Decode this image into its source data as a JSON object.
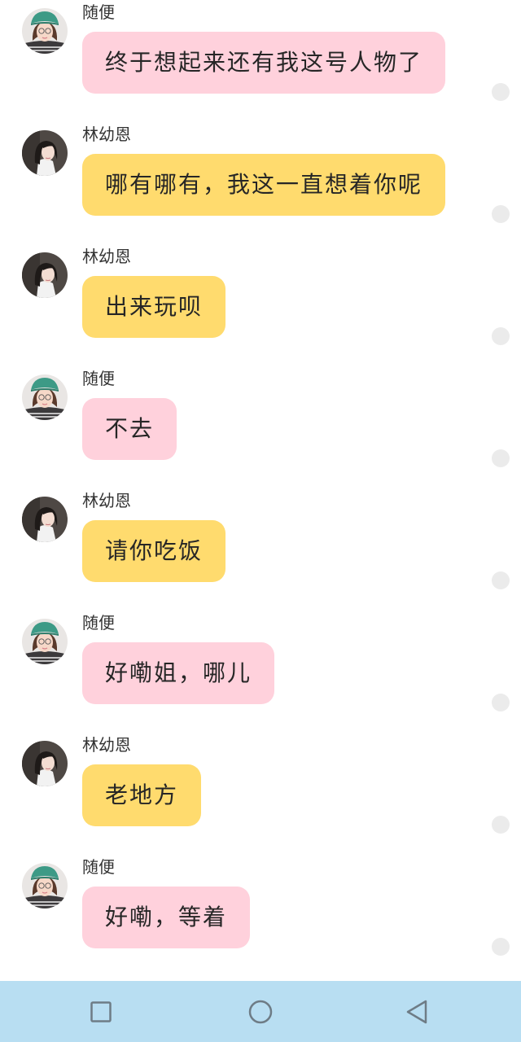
{
  "colors": {
    "pink_bubble": "#ffd1dc",
    "yellow_bubble": "#ffdb6e",
    "nav_bar": "#b8def2",
    "read_dot": "#ebebeb"
  },
  "messages": [
    {
      "sender": "随便",
      "text": "终于想起来还有我这号人物了",
      "bubble": "pink",
      "avatar": "green-cap-girl-avatar"
    },
    {
      "sender": "林幼恩",
      "text": "哪有哪有，我这一直想着你呢",
      "bubble": "yellow",
      "avatar": "dark-hair-girl-avatar"
    },
    {
      "sender": "林幼恩",
      "text": "出来玩呗",
      "bubble": "yellow",
      "avatar": "dark-hair-girl-avatar"
    },
    {
      "sender": "随便",
      "text": "不去",
      "bubble": "pink",
      "avatar": "green-cap-girl-avatar"
    },
    {
      "sender": "林幼恩",
      "text": "请你吃饭",
      "bubble": "yellow",
      "avatar": "dark-hair-girl-avatar"
    },
    {
      "sender": "随便",
      "text": "好嘞姐，哪儿",
      "bubble": "pink",
      "avatar": "green-cap-girl-avatar"
    },
    {
      "sender": "林幼恩",
      "text": "老地方",
      "bubble": "yellow",
      "avatar": "dark-hair-girl-avatar"
    },
    {
      "sender": "随便",
      "text": "好嘞，等着",
      "bubble": "pink",
      "avatar": "green-cap-girl-avatar"
    }
  ],
  "nav_bar": {
    "buttons": [
      "recent-apps-icon",
      "home-icon",
      "back-icon"
    ]
  }
}
